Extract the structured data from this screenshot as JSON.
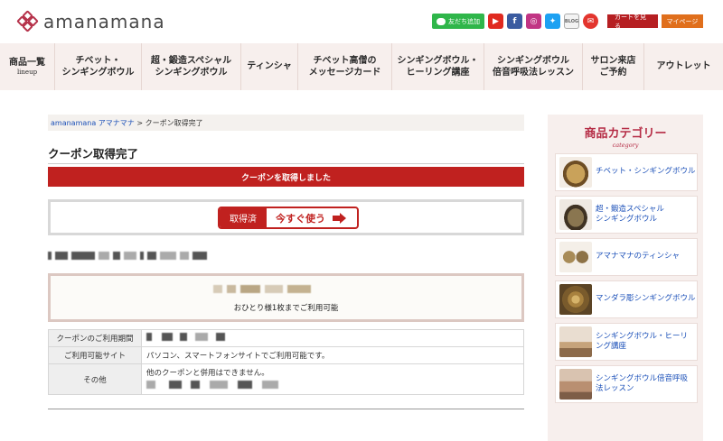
{
  "header": {
    "logo_text": "amanamana",
    "line_label": "友だち追加",
    "blog_label": "BLOG",
    "cart_label": "カートを見る",
    "mypage_label": "マイページ"
  },
  "nav": [
    {
      "label": "商品一覧",
      "sub": "lineup"
    },
    {
      "label": "チベット・\nシンギングボウル"
    },
    {
      "label": "超・鍛造スペシャル\nシンギングボウル"
    },
    {
      "label": "ティンシャ"
    },
    {
      "label": "チベット高僧の\nメッセージカード"
    },
    {
      "label": "シンギングボウル・\nヒーリング講座"
    },
    {
      "label": "シンギングボウル\n倍音呼吸法レッスン"
    },
    {
      "label": "サロン来店\nご予約"
    },
    {
      "label": "アウトレット"
    }
  ],
  "breadcrumb": {
    "home": "amanamana アマナマナ",
    "separator": " > ",
    "current": "クーポン取得完了"
  },
  "main": {
    "title": "クーポン取得完了",
    "banner": "クーポンを取得しました",
    "acquired_label": "取得済",
    "use_now_label": "今すぐ使う",
    "coupon_note": "おひとり様1枚までご利用可能",
    "info_rows": [
      {
        "label": "クーポンのご利用期間",
        "value": ""
      },
      {
        "label": "ご利用可能サイト",
        "value": "パソコン、スマートフォンサイトでご利用可能です。"
      },
      {
        "label": "その他",
        "value": "他のクーポンと併用はできません。"
      }
    ]
  },
  "sidebar": {
    "title": "商品カテゴリー",
    "subtitle": "category",
    "items": [
      {
        "label": "チベット・シンギングボウル",
        "thumb": "#8a6a3a"
      },
      {
        "label": "超・鍛造スペシャル\nシンギングボウル",
        "thumb": "#6b5a40"
      },
      {
        "label": "アマナマナのティンシャ",
        "thumb": "#7d6b4c"
      },
      {
        "label": "マンダラ彫シンギングボウル",
        "thumb": "#9a7a45"
      },
      {
        "label": "シンギングボウル・ヒーリ\nング講座",
        "thumb": "#c9a98a"
      },
      {
        "label": "シンギングボウル倍音呼吸\n法レッスン",
        "thumb": "#b89c84"
      }
    ]
  },
  "colors": {
    "accent": "#c0211f",
    "nav_bg": "#f7efed",
    "link": "#1a4fb8",
    "category_title": "#b52c45"
  }
}
